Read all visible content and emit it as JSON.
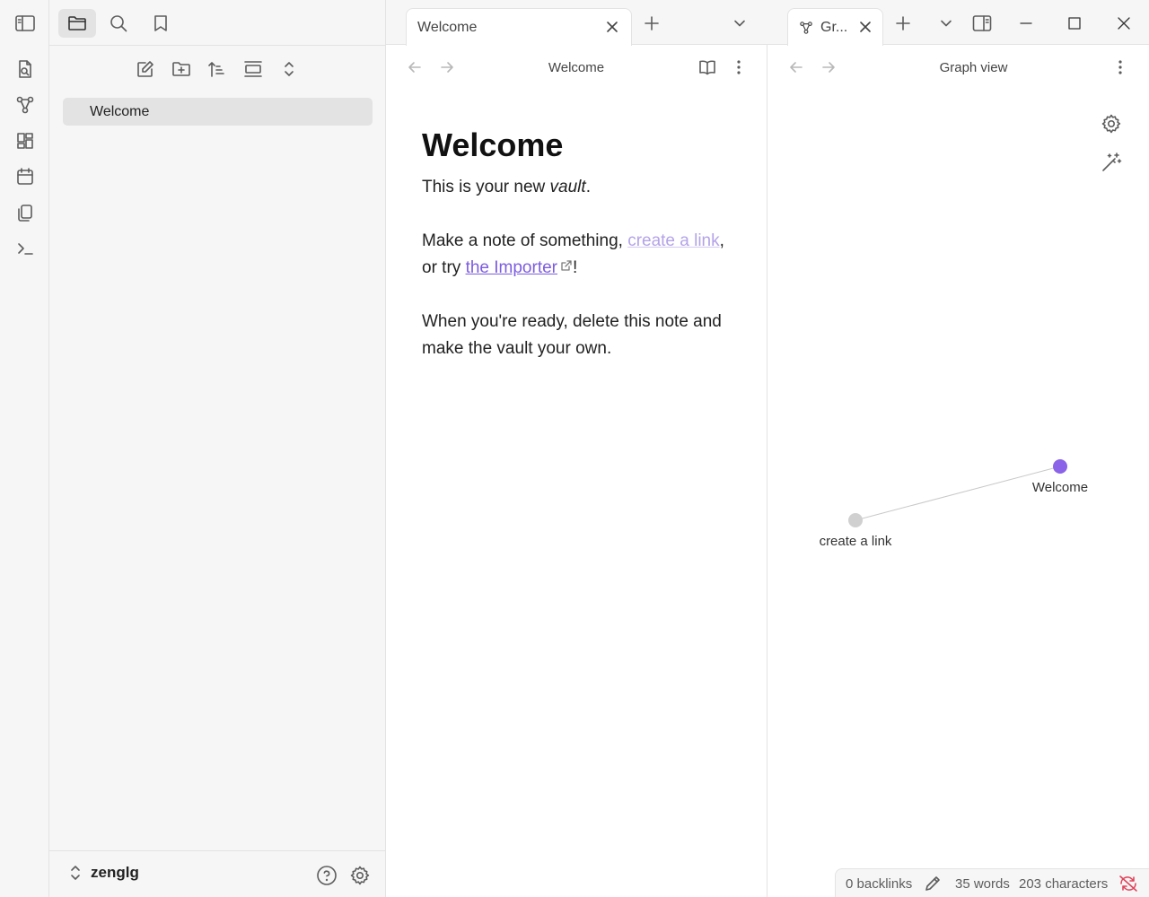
{
  "sidebar": {
    "files": [
      {
        "label": "Welcome"
      }
    ],
    "vault_name": "zenglg"
  },
  "tabs": {
    "note_tab_title": "Welcome",
    "graph_tab_title": "Gr..."
  },
  "note": {
    "header_title": "Welcome",
    "heading": "Welcome",
    "p1_prefix": "This is your new ",
    "p1_em": "vault",
    "p1_suffix": ".",
    "p2_prefix": "Make a note of something, ",
    "p2_link1": "create a link",
    "p2_middle": ", or try ",
    "p2_link2": "the Importer",
    "p2_suffix": "!",
    "p3": "When you're ready, delete this note and make the vault your own."
  },
  "graph": {
    "header_title": "Graph view",
    "nodes": [
      {
        "label": "Welcome",
        "resolved": true
      },
      {
        "label": "create a link",
        "resolved": false
      }
    ],
    "edges": [
      [
        "Welcome",
        "create a link"
      ]
    ]
  },
  "status": {
    "backlinks": "0 backlinks",
    "words": "35 words",
    "characters": "203 characters"
  },
  "colors": {
    "accent": "#7c5ce0",
    "node_resolved": "#8a63e8",
    "node_unresolved": "#d0d0d0",
    "unresolved_link": "#b3a3e8",
    "sync_error": "#e0455b"
  },
  "icons": {
    "ribbon": [
      "switcher-icon",
      "graph-icon",
      "canvas-icon",
      "daily-note-icon",
      "templates-icon",
      "command-palette-icon"
    ],
    "sidebar_tabs": [
      "sidebar-toggle-icon",
      "files-icon",
      "search-icon",
      "bookmark-icon"
    ],
    "file_actions": [
      "new-note-icon",
      "new-folder-icon",
      "sort-icon",
      "auto-reveal-icon",
      "collapse-all-icon"
    ]
  }
}
